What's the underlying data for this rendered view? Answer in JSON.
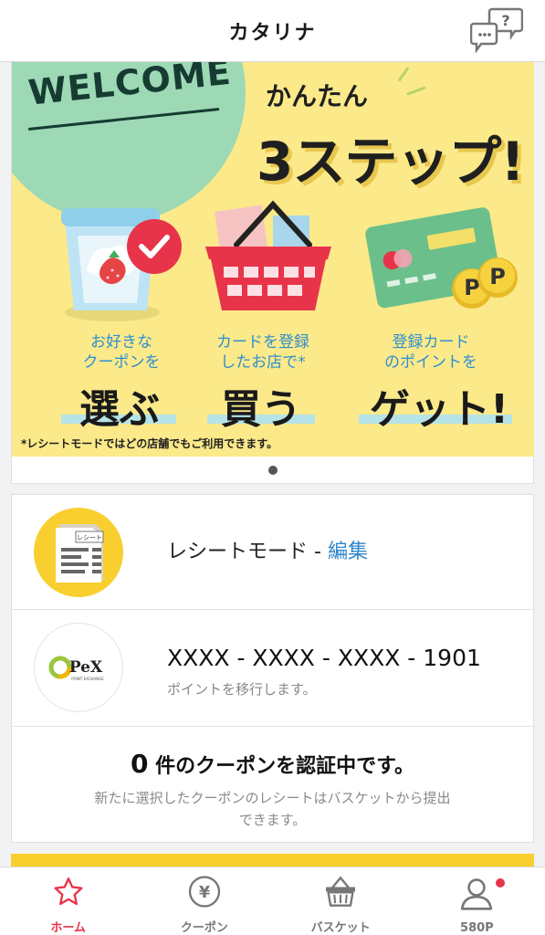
{
  "header": {
    "title": "カタリナ",
    "help_icon": "chat-question-icon"
  },
  "banner": {
    "welcome": "WELCOME",
    "kantan": "かんたん",
    "steps_title": "3ステップ!",
    "steps": [
      {
        "caption_1": "お好きな",
        "caption_2": "クーポンを",
        "big": "選ぶ",
        "icon": "coupon-cup-icon"
      },
      {
        "caption_1": "カードを登録",
        "caption_2": "したお店で*",
        "big": "買う",
        "icon": "basket-icon"
      },
      {
        "caption_1": "登録カード",
        "caption_2": "のポイントを",
        "big": "ゲット!",
        "icon": "card-points-icon"
      }
    ],
    "note": "*レシートモードではどの店舗でもご利用できます。",
    "receipt_mini_label": "レシート",
    "pex_logo": "PeX",
    "pex_logo_sub": "POINT EXCHANGE"
  },
  "receipt_mode": {
    "label": "レシートモード - ",
    "edit": "編集"
  },
  "pex": {
    "card_number": "XXXX - XXXX - XXXX - 1901",
    "sub": "ポイントを移行します。"
  },
  "coupon_status": {
    "count": "0",
    "main": " 件のクーポンを認証中です。",
    "sub": "新たに選択したクーポンのレシートはバスケットから提出できます。"
  },
  "tabs": [
    {
      "label": "ホーム",
      "icon": "star-icon",
      "active": true
    },
    {
      "label": "クーポン",
      "icon": "yen-coin-icon",
      "active": false
    },
    {
      "label": "バスケット",
      "icon": "basket-icon",
      "active": false
    },
    {
      "label": "580P",
      "icon": "user-icon",
      "active": false
    }
  ],
  "colors": {
    "accent": "#e8344a",
    "banner_bg": "#fbe98a",
    "link": "#2f86c9",
    "yellow": "#f8cf2e"
  }
}
